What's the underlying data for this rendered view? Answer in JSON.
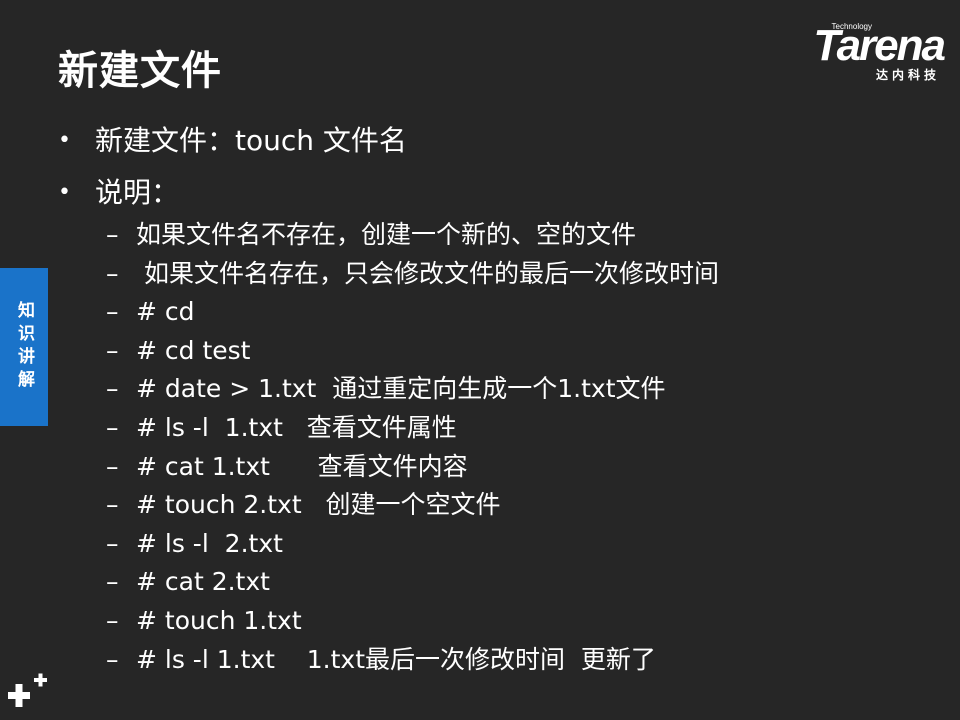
{
  "title": "新建文件",
  "logo": {
    "technology": "Technology",
    "brand": "Tarena",
    "subtitle": "达内科技"
  },
  "side_tab": "知识讲解",
  "bullets": [
    {
      "text": "新建文件：touch 文件名"
    },
    {
      "text": "说明："
    }
  ],
  "subitems": [
    "如果文件名不存在，创建一个新的、空的文件",
    " 如果文件名存在，只会修改文件的最后一次修改时间",
    "# cd",
    "# cd test",
    "# date > 1.txt  通过重定向生成一个1.txt文件",
    "# ls -l  1.txt   查看文件属性",
    "# cat 1.txt      查看文件内容",
    "# touch 2.txt   创建一个空文件",
    "# ls -l  2.txt",
    "# cat 2.txt",
    "# touch 1.txt",
    "# ls -l 1.txt    1.txt最后一次修改时间  更新了"
  ],
  "bullet_marker": "•",
  "sub_marker": "–",
  "colors": {
    "background": "#262626",
    "side_tab": "#1a73c9",
    "text": "#ffffff"
  },
  "decor_icon": "plus-sign-icon"
}
